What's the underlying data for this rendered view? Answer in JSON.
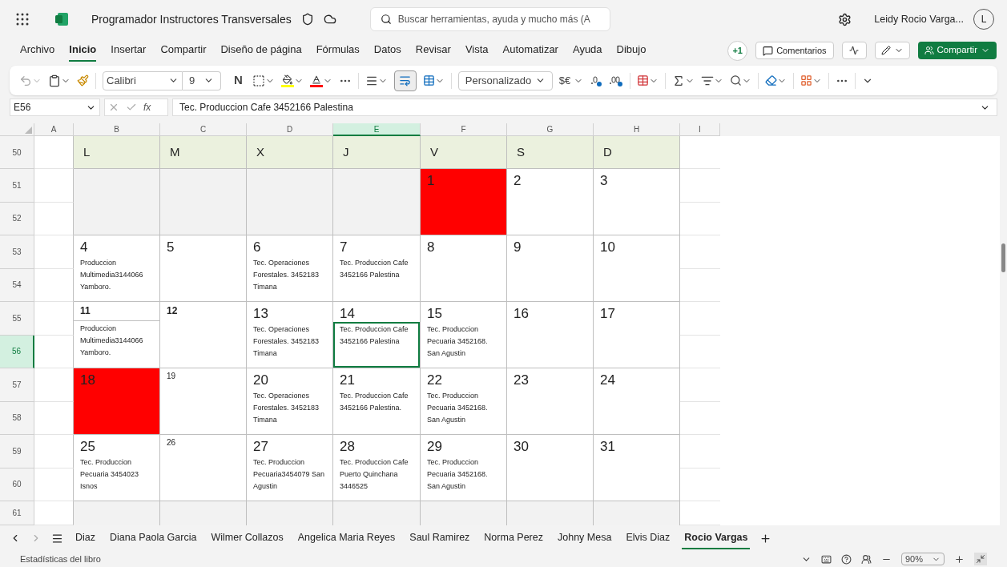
{
  "app": {
    "title": "Programador Instructores Transversales",
    "search_placeholder": "Buscar herramientas, ayuda y mucho más (A",
    "user": "Leidy Rocio Varga...",
    "avatar": "L"
  },
  "menu": [
    {
      "label": "Archivo",
      "selected": false
    },
    {
      "label": "Inicio",
      "selected": true
    },
    {
      "label": "Insertar",
      "selected": false
    },
    {
      "label": "Compartir",
      "selected": false
    },
    {
      "label": "Diseño de página",
      "selected": false
    },
    {
      "label": "Fórmulas",
      "selected": false
    },
    {
      "label": "Datos",
      "selected": false
    },
    {
      "label": "Revisar",
      "selected": false
    },
    {
      "label": "Vista",
      "selected": false
    },
    {
      "label": "Automatizar",
      "selected": false
    },
    {
      "label": "Ayuda",
      "selected": false
    },
    {
      "label": "Dibujo",
      "selected": false
    }
  ],
  "actions": {
    "presence": "+1",
    "comments": "Comentarios",
    "share": "Compartir"
  },
  "toolbar": {
    "font": "Calibri",
    "size": "9",
    "bold": "N",
    "currency": "$€",
    "number_format": "Personalizado"
  },
  "formula_bar": {
    "cell": "E56",
    "fx": "fx",
    "value": "Tec. Produccion Cafe 3452166 Palestina"
  },
  "columns": [
    {
      "label": "A",
      "selected": false
    },
    {
      "label": "B",
      "selected": false
    },
    {
      "label": "C",
      "selected": false
    },
    {
      "label": "D",
      "selected": false
    },
    {
      "label": "E",
      "selected": true
    },
    {
      "label": "F",
      "selected": false
    },
    {
      "label": "G",
      "selected": false
    },
    {
      "label": "H",
      "selected": false
    },
    {
      "label": "I",
      "selected": false
    }
  ],
  "rows": [
    {
      "label": "50",
      "selected": false
    },
    {
      "label": "51",
      "selected": false
    },
    {
      "label": "52",
      "selected": false
    },
    {
      "label": "53",
      "selected": false
    },
    {
      "label": "54",
      "selected": false
    },
    {
      "label": "55",
      "selected": false
    },
    {
      "label": "56",
      "selected": true
    },
    {
      "label": "57",
      "selected": false
    },
    {
      "label": "58",
      "selected": false
    },
    {
      "label": "59",
      "selected": false
    },
    {
      "label": "60",
      "selected": false
    },
    {
      "label": "61",
      "selected": false
    }
  ],
  "calendar": {
    "headers": [
      "L",
      "M",
      "X",
      "J",
      "V",
      "S",
      "D"
    ],
    "weeks": [
      [
        {
          "kind": "blank"
        },
        {
          "kind": "blank"
        },
        {
          "kind": "blank"
        },
        {
          "kind": "blank"
        },
        {
          "kind": "day",
          "day": "1",
          "highlight": true,
          "selected": false
        },
        {
          "kind": "day",
          "day": "2",
          "highlight": false,
          "selected": false
        },
        {
          "kind": "day",
          "day": "3",
          "highlight": false,
          "selected": false
        }
      ],
      [
        {
          "kind": "day",
          "day": "4",
          "note": "Produccion Multimedia3144066 Yamboro.",
          "highlight": false,
          "selected": false
        },
        {
          "kind": "day",
          "day": "5",
          "highlight": false,
          "selected": false
        },
        {
          "kind": "day",
          "day": "6",
          "note": "Tec. Operaciones Forestales. 3452183 Timana",
          "highlight": false,
          "selected": false
        },
        {
          "kind": "day",
          "day": "7",
          "note": "Tec. Produccion Cafe 3452166 Palestina",
          "highlight": false,
          "selected": false
        },
        {
          "kind": "day",
          "day": "8",
          "highlight": false,
          "selected": false
        },
        {
          "kind": "day",
          "day": "9",
          "highlight": false,
          "selected": false
        },
        {
          "kind": "day",
          "day": "10",
          "highlight": false,
          "selected": false
        }
      ],
      [
        {
          "kind": "boldday",
          "day": "11",
          "note": "Produccion Multimedia3144066 Yamboro.",
          "highlight": false,
          "selected": false
        },
        {
          "kind": "boldday",
          "day": "12",
          "highlight": false,
          "selected": false
        },
        {
          "kind": "day",
          "day": "13",
          "note": "Tec. Operaciones Forestales. 3452183 Timana",
          "highlight": false,
          "selected": false
        },
        {
          "kind": "day",
          "day": "14",
          "note": "Tec. Produccion Cafe 3452166 Palestina",
          "highlight": false,
          "selected": true
        },
        {
          "kind": "day",
          "day": "15",
          "note": "Tec. Produccion Pecuaria 3452168. San Agustin",
          "highlight": false,
          "selected": false
        },
        {
          "kind": "day",
          "day": "16",
          "highlight": false,
          "selected": false
        },
        {
          "kind": "day",
          "day": "17",
          "highlight": false,
          "selected": false
        }
      ],
      [
        {
          "kind": "day",
          "day": "18",
          "highlight": true,
          "selected": false
        },
        {
          "kind": "smallday",
          "day": "19",
          "highlight": false,
          "selected": false
        },
        {
          "kind": "day",
          "day": "20",
          "note": "Tec. Operaciones Forestales. 3452183 Timana",
          "highlight": false,
          "selected": false
        },
        {
          "kind": "day",
          "day": "21",
          "note": "Tec. Produccion Cafe 3452166 Palestina.",
          "highlight": false,
          "selected": false
        },
        {
          "kind": "day",
          "day": "22",
          "note": "Tec. Produccion Pecuaria 3452168. San Agustin",
          "highlight": false,
          "selected": false
        },
        {
          "kind": "day",
          "day": "23",
          "highlight": false,
          "selected": false
        },
        {
          "kind": "day",
          "day": "24",
          "highlight": false,
          "selected": false
        }
      ],
      [
        {
          "kind": "day",
          "day": "25",
          "note": "Tec. Produccion Pecuaria 3454023 Isnos",
          "highlight": false,
          "selected": false
        },
        {
          "kind": "smallday",
          "day": "26",
          "highlight": false,
          "selected": false
        },
        {
          "kind": "day",
          "day": "27",
          "note": "Tec. Produccion Pecuaria3454079 San Agustin",
          "highlight": false,
          "selected": false
        },
        {
          "kind": "day",
          "day": "28",
          "note": "Tec. Produccion Cafe Puerto Quinchana 3446525",
          "highlight": false,
          "selected": false
        },
        {
          "kind": "day",
          "day": "29",
          "note": "Tec. Produccion Pecuaria 3452168. San Agustin",
          "highlight": false,
          "selected": false
        },
        {
          "kind": "day",
          "day": "30",
          "highlight": false,
          "selected": false
        },
        {
          "kind": "day",
          "day": "31",
          "highlight": false,
          "selected": false
        }
      ]
    ]
  },
  "sheets": [
    {
      "label": "Diaz",
      "selected": false
    },
    {
      "label": "Diana Paola Garcia",
      "selected": false
    },
    {
      "label": "Wilmer Collazos",
      "selected": false
    },
    {
      "label": "Angelica Maria Reyes",
      "selected": false
    },
    {
      "label": "Saul Ramirez",
      "selected": false
    },
    {
      "label": "Norma Perez",
      "selected": false
    },
    {
      "label": "Johny Mesa",
      "selected": false
    },
    {
      "label": "Elvis Diaz",
      "selected": false
    },
    {
      "label": "Rocio Vargas",
      "selected": true
    }
  ],
  "status": {
    "label": "Estadísticas del libro",
    "zoom": "90%"
  }
}
